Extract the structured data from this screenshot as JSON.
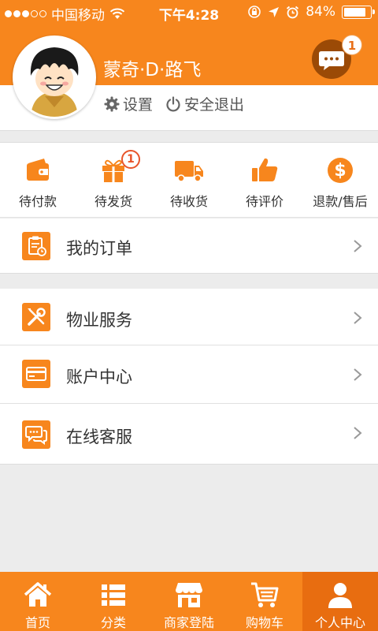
{
  "status_bar": {
    "carrier": "中国移动",
    "time": "下午4:28",
    "battery": "84%",
    "battery_level": 0.84
  },
  "profile": {
    "username": "蒙奇·D·路飞",
    "settings_label": "设置",
    "logout_label": "安全退出",
    "message_badge": "1"
  },
  "order_status": [
    {
      "label": "待付款",
      "icon": "wallet-icon"
    },
    {
      "label": "待发货",
      "icon": "gift-icon",
      "badge": "1"
    },
    {
      "label": "待收货",
      "icon": "truck-icon"
    },
    {
      "label": "待评价",
      "icon": "thumbs-up-icon"
    },
    {
      "label": "退款/售后",
      "icon": "dollar-icon"
    }
  ],
  "menu": {
    "orders": "我的订单",
    "property": "物业服务",
    "account": "账户中心",
    "service": "在线客服"
  },
  "tabs": [
    {
      "label": "首页",
      "icon": "home-icon"
    },
    {
      "label": "分类",
      "icon": "list-icon"
    },
    {
      "label": "商家登陆",
      "icon": "store-icon"
    },
    {
      "label": "购物车",
      "icon": "cart-icon"
    },
    {
      "label": "个人中心",
      "icon": "user-icon",
      "active": true
    }
  ],
  "colors": {
    "accent": "#f7861d",
    "active_tab": "#e86d10",
    "badge": "#e8542a"
  }
}
